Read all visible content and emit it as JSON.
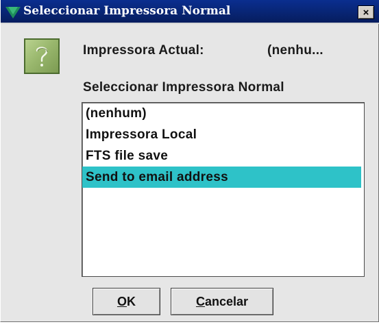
{
  "window": {
    "title": "Seleccionar Impressora Normal",
    "close_label": "×",
    "title_icon": "app-logo-icon",
    "close_icon": "close-icon"
  },
  "info": {
    "icon": "question-icon",
    "current_label": "Impressora Actual:",
    "current_value": "(nenhu..."
  },
  "list": {
    "heading": "Seleccionar Impressora Normal",
    "items": [
      {
        "label": "(nenhum)",
        "selected": false
      },
      {
        "label": "Impressora Local",
        "selected": false
      },
      {
        "label": "FTS file save",
        "selected": false
      },
      {
        "label": "Send to email address",
        "selected": true
      }
    ],
    "selection_color": "#2ec2c8"
  },
  "buttons": {
    "ok_mnemonic": "O",
    "ok_rest": "K",
    "cancel_mnemonic": "C",
    "cancel_rest": "ancelar"
  },
  "colors": {
    "titlebar": "#082574",
    "dialog_bg": "#e6e6e6",
    "icon_green": "#9ab86e"
  }
}
